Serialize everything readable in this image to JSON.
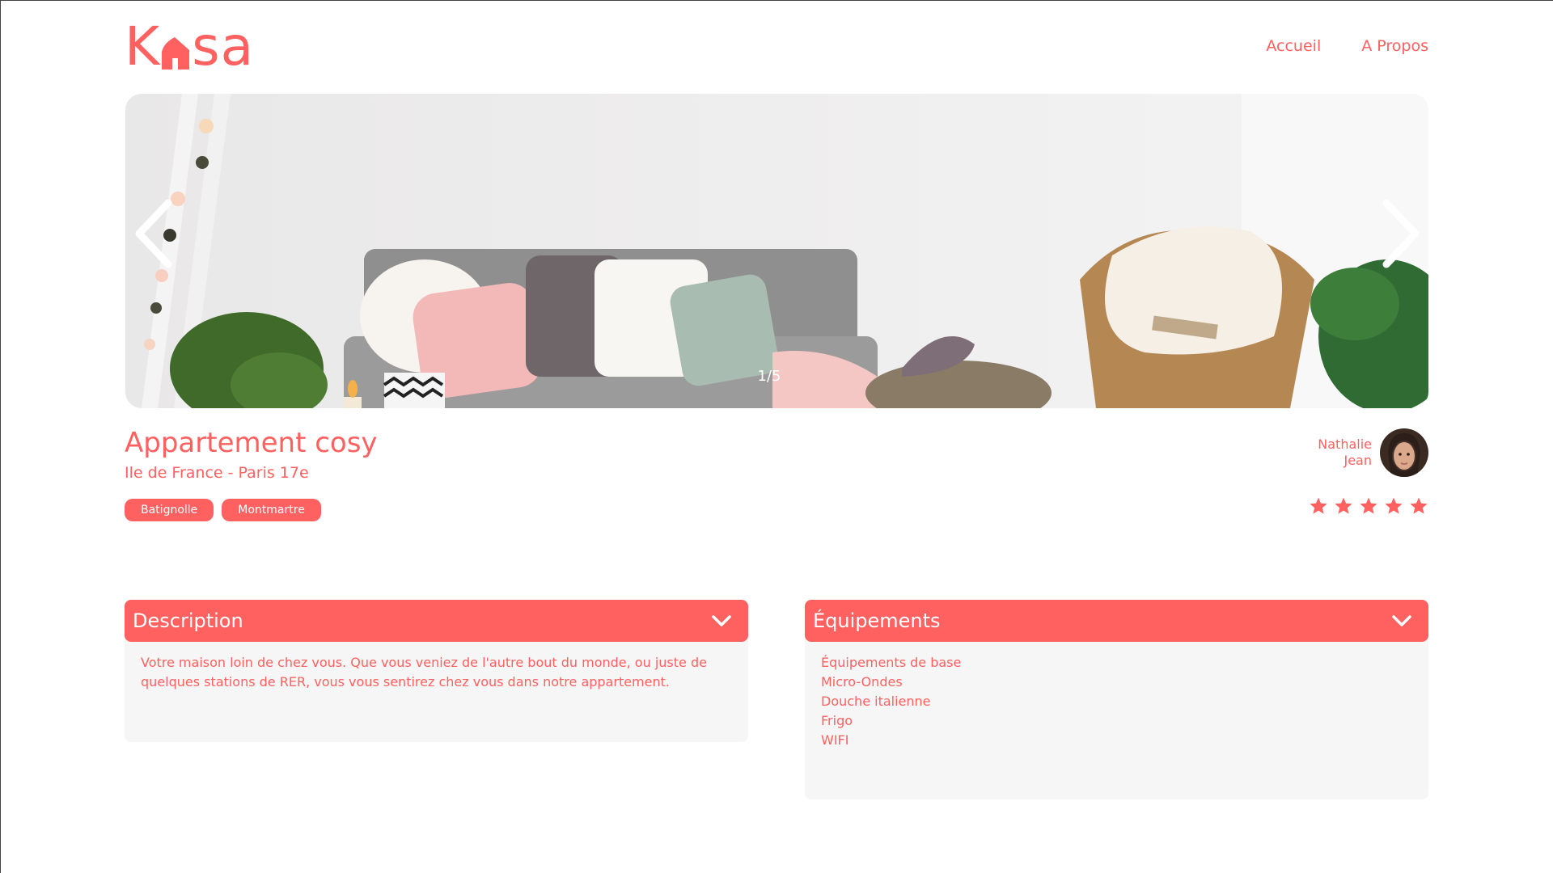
{
  "brand": {
    "logo_text_1": "K",
    "logo_text_2": "sa",
    "accent_color": "#FF6060"
  },
  "nav": {
    "home": "Accueil",
    "about": "A Propos"
  },
  "carousel": {
    "counter": "1/5",
    "prev_icon": "chevron-left-icon",
    "next_icon": "chevron-right-icon"
  },
  "listing": {
    "title": "Appartement cosy",
    "location": "Ile de France - Paris 17e",
    "tags": [
      "Batignolle",
      "Montmartre"
    ],
    "rating": 5,
    "rating_max": 5
  },
  "host": {
    "first_name": "Nathalie",
    "last_name": "Jean"
  },
  "description": {
    "title": "Description",
    "text": "Votre maison loin de chez vous. Que vous veniez de l'autre bout du monde, ou juste de quelques stations de RER, vous vous sentirez chez vous dans notre appartement."
  },
  "equipments": {
    "title": "Équipements",
    "items": [
      "Équipements de base",
      "Micro-Ondes",
      "Douche italienne",
      "Frigo",
      "WIFI"
    ]
  }
}
